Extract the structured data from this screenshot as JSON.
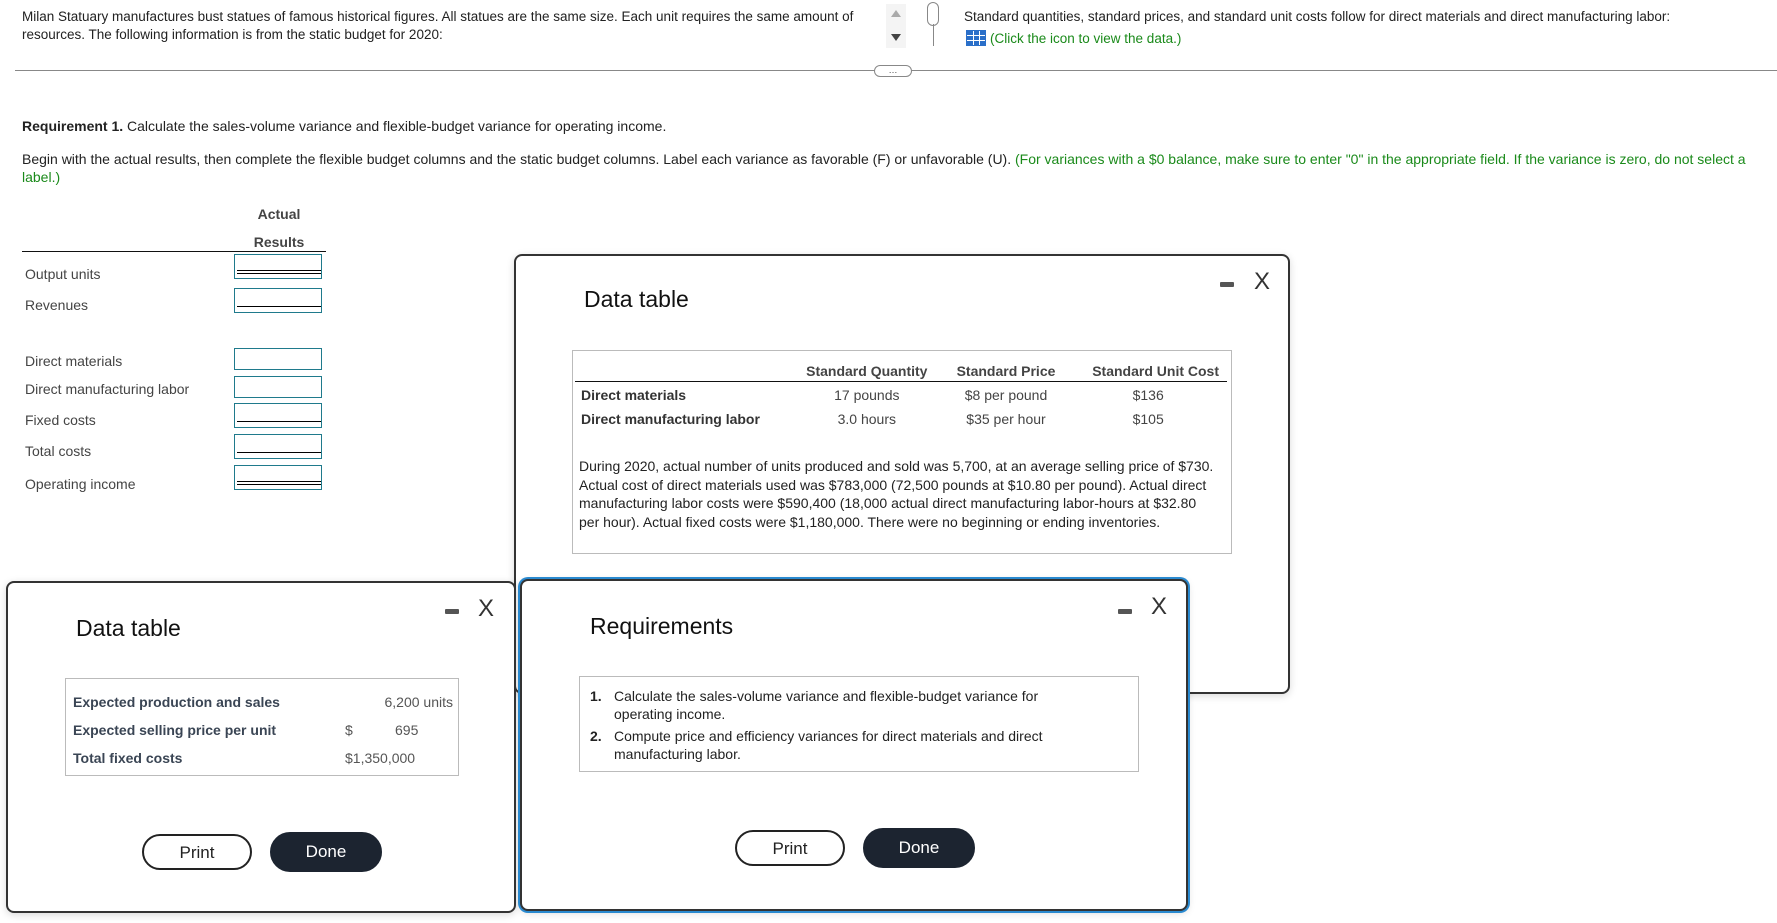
{
  "header": {
    "intro": "Milan Statuary manufactures bust statues of famous historical figures. All statues are the same size. Each unit requires the same amount of resources. The following information is from the static budget for 2020:",
    "standards_intro": "Standard quantities, standard prices, and standard unit costs follow for direct materials and direct manufacturing labor:",
    "data_link": "(Click the icon to view the data.)",
    "splitter_handle": "…"
  },
  "requirement": {
    "label": "Requirement 1.",
    "text": " Calculate the sales-volume variance and flexible-budget variance for operating income.",
    "instructions": "Begin with the actual results, then complete the flexible budget columns and the static budget columns. Label each variance as favorable (F) or unfavorable (U). ",
    "instructions_note": "(For variances with a $0 balance, make sure to enter \"0\" in the appropriate field. If the variance is zero, do not select a label.)"
  },
  "worksheet": {
    "column_header_line1": "Actual",
    "column_header_line2": "Results",
    "rows": [
      {
        "label": "Output units",
        "value": ""
      },
      {
        "label": "Revenues",
        "value": ""
      },
      {
        "label": "Direct materials",
        "value": ""
      },
      {
        "label": "Direct manufacturing labor",
        "value": ""
      },
      {
        "label": "Fixed costs",
        "value": ""
      },
      {
        "label": "Total costs",
        "value": ""
      },
      {
        "label": "Operating income",
        "value": ""
      }
    ]
  },
  "standards_modal": {
    "title": "Data table",
    "minimize": "minimize",
    "close": "X",
    "headers": [
      "",
      "Standard Quantity",
      "Standard Price",
      "Standard Unit Cost"
    ],
    "rows": [
      {
        "item": "Direct materials",
        "quantity": "17 pounds",
        "price": "$8 per pound",
        "unit_cost": "$136"
      },
      {
        "item": "Direct manufacturing labor",
        "quantity": "3.0 hours",
        "price": "$35 per hour",
        "unit_cost": "$105"
      }
    ],
    "paragraph": "During 2020, actual number of units produced and sold was 5,700, at an average selling price of $730. Actual cost of direct materials used was $783,000 (72,500 pounds at $10.80 per pound). Actual direct manufacturing labor costs were $590,400 (18,000 actual direct manufacturing labor-hours at $32.80 per hour). Actual fixed costs were $1,180,000. There were no beginning or ending inventories."
  },
  "budget_modal": {
    "title": "Data table",
    "close": "X",
    "rows": [
      {
        "label": "Expected production and sales",
        "currency": "",
        "value": "6,200 units"
      },
      {
        "label": "Expected selling price per unit",
        "currency": "$",
        "value": "695"
      },
      {
        "label": "Total fixed costs",
        "currency": "",
        "value": "$1,350,000"
      }
    ],
    "print_label": "Print",
    "done_label": "Done"
  },
  "requirements_modal": {
    "title": "Requirements",
    "close": "X",
    "items": [
      {
        "num": "1.",
        "text": "Calculate the sales-volume variance and flexible-budget variance for operating income."
      },
      {
        "num": "2.",
        "text": "Compute price and efficiency variances for direct materials and direct manufacturing labor."
      }
    ],
    "print_label": "Print",
    "done_label": "Done"
  }
}
